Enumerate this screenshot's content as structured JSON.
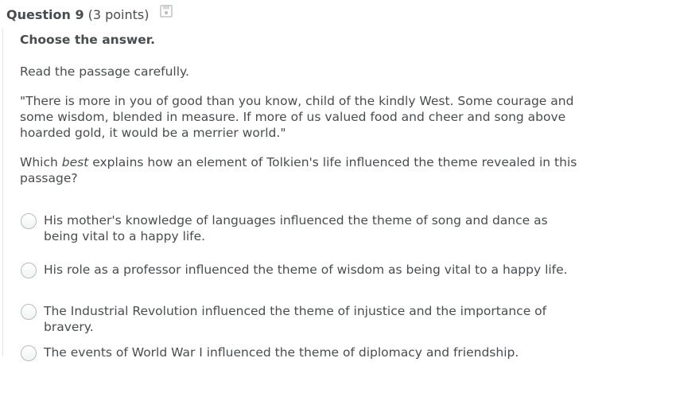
{
  "question": {
    "title": "Question 9",
    "points": "(3 points)",
    "save_icon": "save-icon"
  },
  "body": {
    "instruction": "Choose the answer.",
    "read_prompt": "Read the passage carefully.",
    "quote": "\"There is more in you of good than you know, child of the kindly West. Some courage and some wisdom, blended in measure. If more of us valued food and cheer and song above hoarded gold, it would be a merrier world.\"",
    "question_prefix": "Which ",
    "question_emphasis": "best",
    "question_suffix": " explains how an element of Tolkien's life influenced the theme revealed in this passage?"
  },
  "options": [
    {
      "label": "His mother's knowledge of languages influenced the theme of song and dance as being vital to a happy life.",
      "selected": false
    },
    {
      "label": "His role as a professor influenced the theme of wisdom as being vital to a happy life.",
      "selected": false
    },
    {
      "label": "The Industrial Revolution influenced the theme of injustice and the importance of bravery.",
      "selected": false
    },
    {
      "label": "The events of World War I influenced the theme of diplomacy and friendship.",
      "selected": false
    }
  ]
}
